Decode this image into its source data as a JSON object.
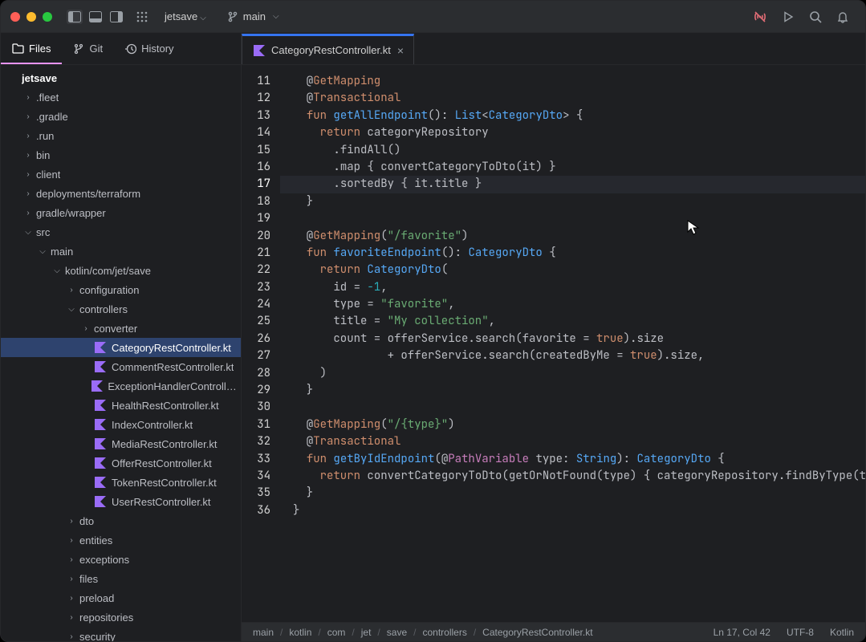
{
  "titlebar": {
    "project": "jetsave",
    "branch": "main"
  },
  "sidebar": {
    "tabs": [
      {
        "label": "Files",
        "icon": "folder"
      },
      {
        "label": "Git",
        "icon": "git"
      },
      {
        "label": "History",
        "icon": "history"
      }
    ],
    "tree": [
      {
        "name": "jetsave",
        "depth": 0,
        "arrow": "",
        "icon": "",
        "proj": true
      },
      {
        "name": ".fleet",
        "depth": 1,
        "arrow": ">",
        "icon": ""
      },
      {
        "name": ".gradle",
        "depth": 1,
        "arrow": ">",
        "icon": ""
      },
      {
        "name": ".run",
        "depth": 1,
        "arrow": ">",
        "icon": ""
      },
      {
        "name": "bin",
        "depth": 1,
        "arrow": ">",
        "icon": ""
      },
      {
        "name": "client",
        "depth": 1,
        "arrow": ">",
        "icon": ""
      },
      {
        "name": "deployments/terraform",
        "depth": 1,
        "arrow": ">",
        "icon": ""
      },
      {
        "name": "gradle/wrapper",
        "depth": 1,
        "arrow": ">",
        "icon": ""
      },
      {
        "name": "src",
        "depth": 1,
        "arrow": "v",
        "icon": ""
      },
      {
        "name": "main",
        "depth": 2,
        "arrow": "v",
        "icon": ""
      },
      {
        "name": "kotlin/com/jet/save",
        "depth": 3,
        "arrow": "v",
        "icon": ""
      },
      {
        "name": "configuration",
        "depth": 4,
        "arrow": ">",
        "icon": ""
      },
      {
        "name": "controllers",
        "depth": 4,
        "arrow": "v",
        "icon": ""
      },
      {
        "name": "converter",
        "depth": 5,
        "arrow": ">",
        "icon": ""
      },
      {
        "name": "CategoryRestController.kt",
        "depth": 5,
        "arrow": "",
        "icon": "kt",
        "sel": true
      },
      {
        "name": "CommentRestController.kt",
        "depth": 5,
        "arrow": "",
        "icon": "kt"
      },
      {
        "name": "ExceptionHandlerController.kt",
        "depth": 5,
        "arrow": "",
        "icon": "kt"
      },
      {
        "name": "HealthRestController.kt",
        "depth": 5,
        "arrow": "",
        "icon": "kt"
      },
      {
        "name": "IndexController.kt",
        "depth": 5,
        "arrow": "",
        "icon": "kt"
      },
      {
        "name": "MediaRestController.kt",
        "depth": 5,
        "arrow": "",
        "icon": "kt"
      },
      {
        "name": "OfferRestController.kt",
        "depth": 5,
        "arrow": "",
        "icon": "kt"
      },
      {
        "name": "TokenRestController.kt",
        "depth": 5,
        "arrow": "",
        "icon": "kt"
      },
      {
        "name": "UserRestController.kt",
        "depth": 5,
        "arrow": "",
        "icon": "kt"
      },
      {
        "name": "dto",
        "depth": 4,
        "arrow": ">",
        "icon": ""
      },
      {
        "name": "entities",
        "depth": 4,
        "arrow": ">",
        "icon": ""
      },
      {
        "name": "exceptions",
        "depth": 4,
        "arrow": ">",
        "icon": ""
      },
      {
        "name": "files",
        "depth": 4,
        "arrow": ">",
        "icon": ""
      },
      {
        "name": "preload",
        "depth": 4,
        "arrow": ">",
        "icon": ""
      },
      {
        "name": "repositories",
        "depth": 4,
        "arrow": ">",
        "icon": ""
      },
      {
        "name": "security",
        "depth": 4,
        "arrow": ">",
        "icon": ""
      }
    ]
  },
  "editor": {
    "tab_label": "CategoryRestController.kt",
    "current_line": 17,
    "lines": [
      {
        "n": 11,
        "tokens": [
          [
            "  @",
            "pu"
          ],
          [
            "GetMapping",
            "an"
          ]
        ]
      },
      {
        "n": 12,
        "tokens": [
          [
            "  @",
            "pu"
          ],
          [
            "Transactional",
            "an"
          ]
        ]
      },
      {
        "n": 13,
        "tokens": [
          [
            "  ",
            "pu"
          ],
          [
            "fun",
            "cw"
          ],
          [
            " ",
            "pu"
          ],
          [
            "getAllEndpoint",
            "fn"
          ],
          [
            "(): ",
            "pu"
          ],
          [
            "List",
            "ty"
          ],
          [
            "<",
            "pu"
          ],
          [
            "CategoryDto",
            "ty"
          ],
          [
            "> {",
            "pu"
          ]
        ]
      },
      {
        "n": 14,
        "tokens": [
          [
            "    ",
            "pu"
          ],
          [
            "return",
            "cw"
          ],
          [
            " categoryRepository",
            "id"
          ]
        ]
      },
      {
        "n": 15,
        "tokens": [
          [
            "      .",
            "pu"
          ],
          [
            "findAll",
            "id"
          ],
          [
            "()",
            "pu"
          ]
        ]
      },
      {
        "n": 16,
        "tokens": [
          [
            "      .",
            "pu"
          ],
          [
            "map",
            "id"
          ],
          [
            " { ",
            "pu"
          ],
          [
            "convertCategoryToDto",
            "id"
          ],
          [
            "(it) }",
            "pu"
          ]
        ]
      },
      {
        "n": 17,
        "tokens": [
          [
            "      .",
            "pu"
          ],
          [
            "sortedBy",
            "id"
          ],
          [
            " { it.title }",
            "pu"
          ]
        ]
      },
      {
        "n": 18,
        "tokens": [
          [
            "  }",
            "pu"
          ]
        ]
      },
      {
        "n": 19,
        "tokens": [
          [
            "",
            "pu"
          ]
        ]
      },
      {
        "n": 20,
        "tokens": [
          [
            "  @",
            "pu"
          ],
          [
            "GetMapping",
            "an"
          ],
          [
            "(",
            "pu"
          ],
          [
            "\"/favorite\"",
            "st"
          ],
          [
            ")",
            "pu"
          ]
        ]
      },
      {
        "n": 21,
        "tokens": [
          [
            "  ",
            "pu"
          ],
          [
            "fun",
            "cw"
          ],
          [
            " ",
            "pu"
          ],
          [
            "favoriteEndpoint",
            "fn"
          ],
          [
            "(): ",
            "pu"
          ],
          [
            "CategoryDto",
            "ty"
          ],
          [
            " {",
            "pu"
          ]
        ]
      },
      {
        "n": 22,
        "tokens": [
          [
            "    ",
            "pu"
          ],
          [
            "return",
            "cw"
          ],
          [
            " ",
            "pu"
          ],
          [
            "CategoryDto",
            "ty"
          ],
          [
            "(",
            "pu"
          ]
        ]
      },
      {
        "n": 23,
        "tokens": [
          [
            "      id = ",
            "pu"
          ],
          [
            "-1",
            "nm"
          ],
          [
            ",",
            "pu"
          ]
        ]
      },
      {
        "n": 24,
        "tokens": [
          [
            "      type = ",
            "pu"
          ],
          [
            "\"favorite\"",
            "st"
          ],
          [
            ",",
            "pu"
          ]
        ]
      },
      {
        "n": 25,
        "tokens": [
          [
            "      title = ",
            "pu"
          ],
          [
            "\"My collection\"",
            "st"
          ],
          [
            ",",
            "pu"
          ]
        ]
      },
      {
        "n": 26,
        "tokens": [
          [
            "      count = offerService.",
            "pu"
          ],
          [
            "search",
            "id"
          ],
          [
            "(favorite = ",
            "pu"
          ],
          [
            "true",
            "bl"
          ],
          [
            ").size",
            "pu"
          ]
        ]
      },
      {
        "n": 27,
        "tokens": [
          [
            "              + offerService.",
            "pu"
          ],
          [
            "search",
            "id"
          ],
          [
            "(createdByMe = ",
            "pu"
          ],
          [
            "true",
            "bl"
          ],
          [
            ").size,",
            "pu"
          ]
        ]
      },
      {
        "n": 28,
        "tokens": [
          [
            "    )",
            "pu"
          ]
        ]
      },
      {
        "n": 29,
        "tokens": [
          [
            "  }",
            "pu"
          ]
        ]
      },
      {
        "n": 30,
        "tokens": [
          [
            "",
            "pu"
          ]
        ]
      },
      {
        "n": 31,
        "tokens": [
          [
            "  @",
            "pu"
          ],
          [
            "GetMapping",
            "an"
          ],
          [
            "(",
            "pu"
          ],
          [
            "\"/{type}\"",
            "st"
          ],
          [
            ")",
            "pu"
          ]
        ]
      },
      {
        "n": 32,
        "tokens": [
          [
            "  @",
            "pu"
          ],
          [
            "Transactional",
            "an"
          ]
        ]
      },
      {
        "n": 33,
        "tokens": [
          [
            "  ",
            "pu"
          ],
          [
            "fun",
            "cw"
          ],
          [
            " ",
            "pu"
          ],
          [
            "getByIdEndpoint",
            "fn"
          ],
          [
            "(@",
            "pu"
          ],
          [
            "PathVariable",
            "pa"
          ],
          [
            " type: ",
            "pu"
          ],
          [
            "String",
            "ty"
          ],
          [
            "): ",
            "pu"
          ],
          [
            "CategoryDto",
            "ty"
          ],
          [
            " {",
            "pu"
          ]
        ]
      },
      {
        "n": 34,
        "tokens": [
          [
            "    ",
            "pu"
          ],
          [
            "return",
            "cw"
          ],
          [
            " ",
            "pu"
          ],
          [
            "convertCategoryToDto",
            "id"
          ],
          [
            "(",
            "pu"
          ],
          [
            "getOrNotFound",
            "id"
          ],
          [
            "(type) { categoryRepository.",
            "pu"
          ],
          [
            "findByType",
            "id"
          ],
          [
            "(ty",
            "pu"
          ]
        ]
      },
      {
        "n": 35,
        "tokens": [
          [
            "  }",
            "pu"
          ]
        ]
      },
      {
        "n": 36,
        "tokens": [
          [
            "}",
            "pu"
          ]
        ]
      }
    ]
  },
  "status": {
    "crumbs": [
      "main",
      "kotlin",
      "com",
      "jet",
      "save",
      "controllers",
      "CategoryRestController.kt"
    ],
    "cursor": "Ln 17, Col 42",
    "encoding": "UTF-8",
    "language": "Kotlin"
  }
}
